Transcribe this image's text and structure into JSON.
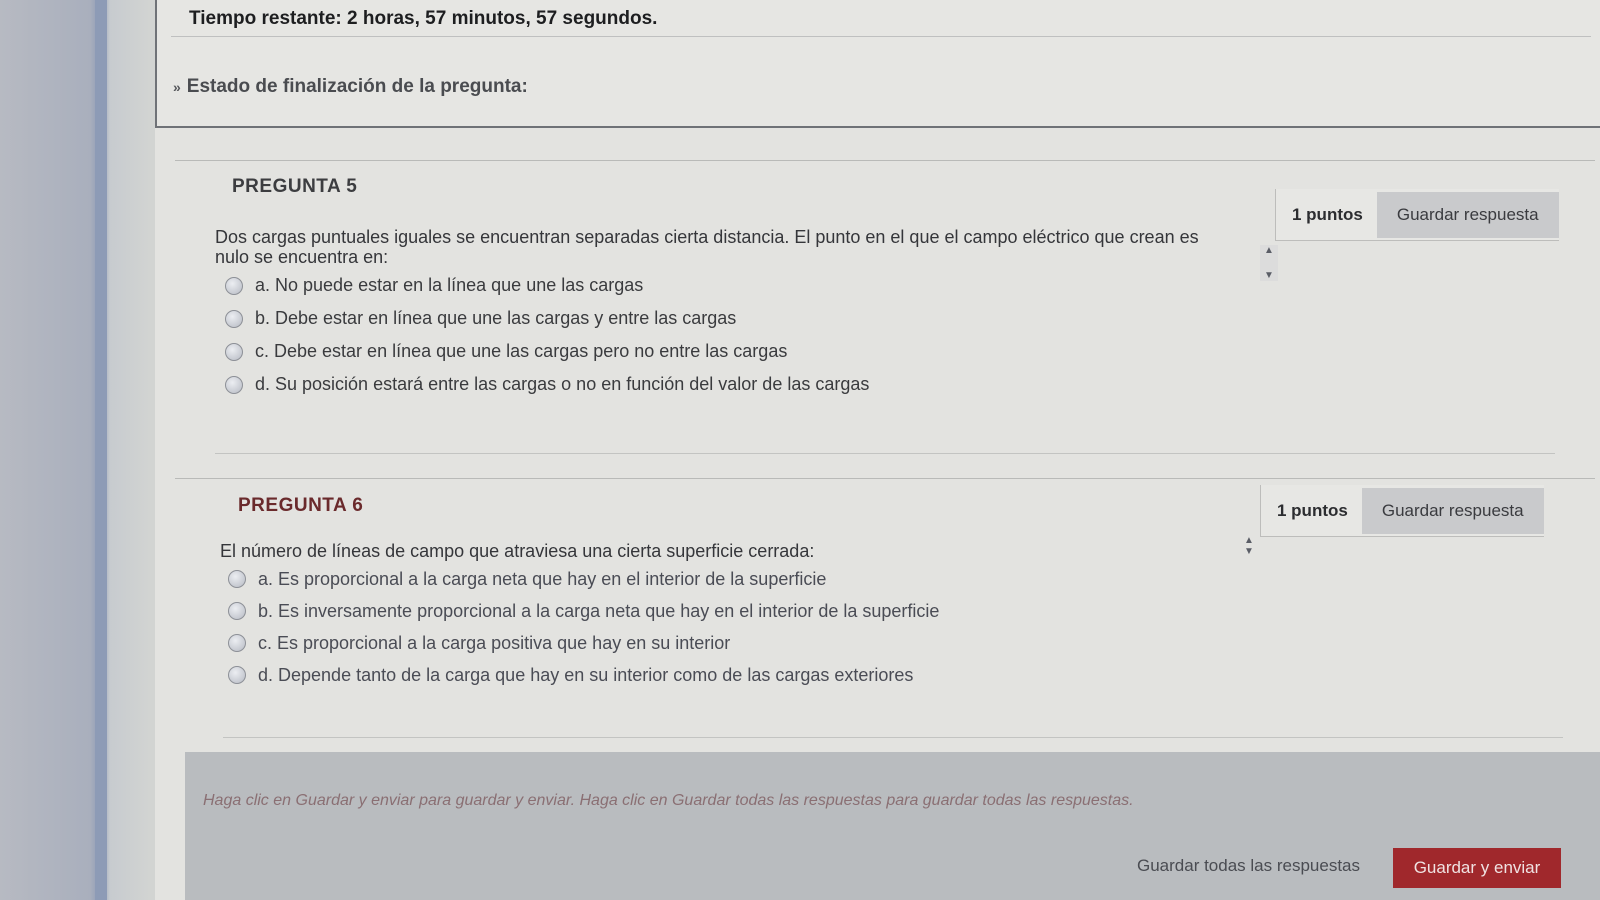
{
  "timer": {
    "text": "Tiempo restante: 2 horas, 57 minutos, 57 segundos."
  },
  "status": {
    "label": "Estado de finalización de la pregunta:"
  },
  "questions": [
    {
      "title": "PREGUNTA 5",
      "points": "1 puntos",
      "save_label": "Guardar respuesta",
      "text_line1": "Dos cargas puntuales iguales se encuentran separadas cierta distancia. El punto en el que el campo eléctrico que crean es",
      "text_line2": "nulo se encuentra en:",
      "options": [
        "a. No puede estar en la línea que une las cargas",
        "b. Debe estar en línea que une las cargas y entre las cargas",
        "c. Debe estar en línea que une las cargas pero no entre las cargas",
        "d. Su posición estará entre las cargas o no en función del valor de las cargas"
      ]
    },
    {
      "title": "PREGUNTA 6",
      "points": "1 puntos",
      "save_label": "Guardar respuesta",
      "text_line1": "El número de líneas de campo que atraviesa una cierta superficie cerrada:",
      "options": [
        "a. Es proporcional a la carga neta que hay en el interior de la superficie",
        "b. Es inversamente proporcional a la carga neta que hay en el interior de la superficie",
        "c. Es proporcional a la carga positiva que hay en su interior",
        "d. Depende tanto de la carga que hay en su interior como de las cargas exteriores"
      ]
    }
  ],
  "footer": {
    "note": "Haga clic en Guardar y enviar para guardar y enviar. Haga clic en Guardar todas las respuestas para guardar todas las respuestas.",
    "save_all_label": "Guardar todas las respuestas",
    "submit_label": "Guardar y enviar"
  },
  "colors": {
    "submit": "#a0282c",
    "question6_title": "#6a2a2c"
  }
}
